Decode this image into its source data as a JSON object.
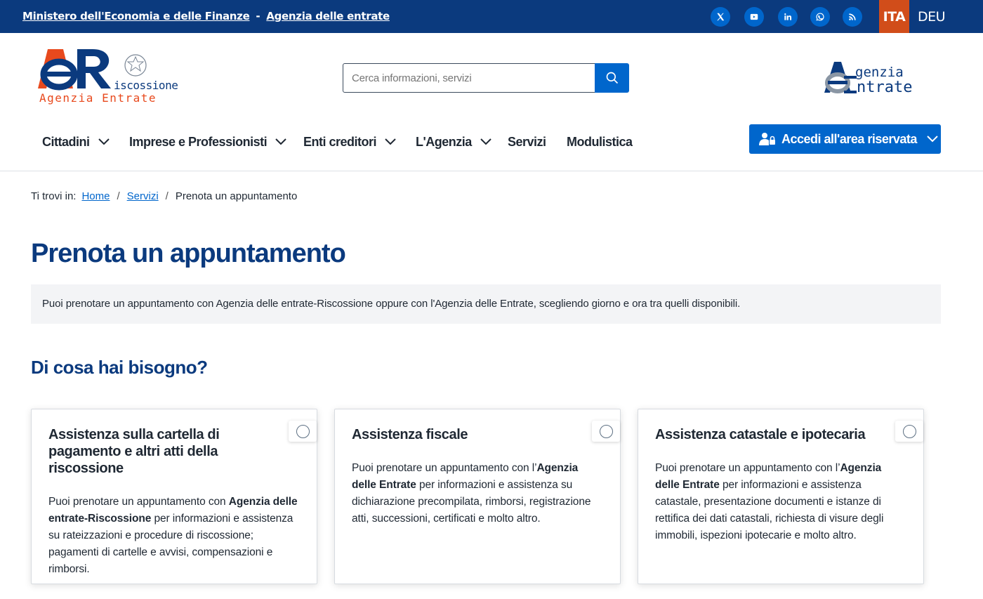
{
  "topbar": {
    "ministry_link": "Ministero dell'Economia e delle Finanze",
    "separator": "-",
    "agency_link": "Agenzia delle entrate",
    "social_icons": [
      "x-icon",
      "youtube-icon",
      "linkedin-icon",
      "whatsapp-icon",
      "rss-icon"
    ],
    "languages": {
      "active": "ITA",
      "other": "DEU"
    }
  },
  "header": {
    "logo_left_text_1": "iscossione",
    "logo_left_text_2": "Agenzia Entrate",
    "search_placeholder": "Cerca informazioni, servizi",
    "logo_right_text_1": "genzia",
    "logo_right_text_2": "ntrate"
  },
  "nav": {
    "items": [
      {
        "label": "Cittadini",
        "has_dropdown": true
      },
      {
        "label": "Imprese e Professionisti",
        "has_dropdown": true
      },
      {
        "label": "Enti creditori",
        "has_dropdown": true
      },
      {
        "label": "L'Agenzia",
        "has_dropdown": true
      },
      {
        "label": "Servizi",
        "has_dropdown": false
      },
      {
        "label": "Modulistica",
        "has_dropdown": false
      }
    ],
    "login_label": "Accedi all'area riservata"
  },
  "breadcrumb": {
    "lead": "Ti trovi in:",
    "home": "Home",
    "servizi": "Servizi",
    "current": "Prenota un appuntamento"
  },
  "main": {
    "title": "Prenota un appuntamento",
    "intro": "Puoi prenotare un appuntamento con Agenzia delle entrate-Riscossione oppure con l'Agenzia delle Entrate, scegliendo giorno e ora tra quelli disponibili.",
    "section_title": "Di cosa hai bisogno?",
    "cards": [
      {
        "title": "Assistenza sulla cartella di pagamento e altri atti della riscossione",
        "text_before": "Puoi prenotare un appuntamento con ",
        "text_bold": "Agenzia delle entrate-Riscossione",
        "text_after": " per informazioni e assistenza su rateizzazioni e procedure di riscossione; pagamenti di cartelle e avvisi, compensazioni e rimborsi."
      },
      {
        "title": "Assistenza fiscale",
        "text_before": "Puoi prenotare un appuntamento con l’",
        "text_bold": "Agenzia delle Entrate",
        "text_after": " per informazioni e assistenza su dichiarazione precompilata, rimborsi, registrazione atti, successioni, certificati e molto altro."
      },
      {
        "title": "Assistenza catastale e ipotecaria",
        "text_before": "Puoi prenotare un appuntamento con l’",
        "text_bold": "Agenzia delle Entrate",
        "text_after": " per informazioni e assistenza catastale, presentazione documenti e istanze di rettifica dei dati catastali, richiesta di visure degli immobili, ispezioni ipotecarie e molto altro."
      }
    ]
  },
  "colors": {
    "primary_dark": "#0b3a7e",
    "primary": "#0066cc",
    "lang_active": "#d14d1a",
    "intro_bg": "#f3f4f6"
  }
}
